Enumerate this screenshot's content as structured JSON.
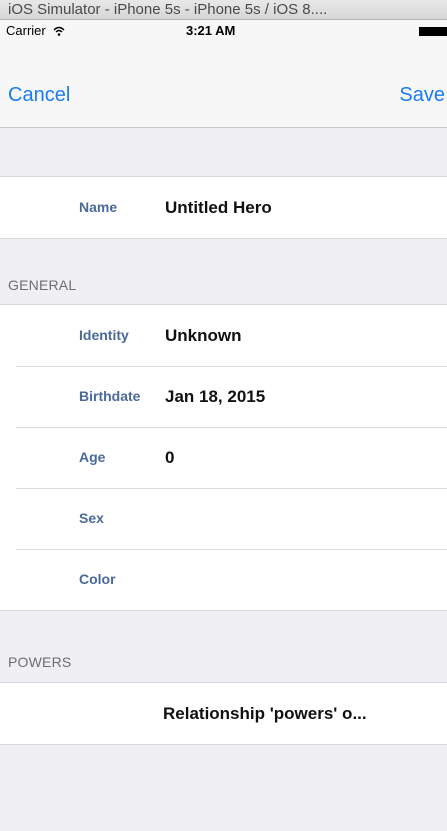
{
  "window": {
    "title": "iOS Simulator - iPhone 5s - iPhone 5s / iOS 8...."
  },
  "status": {
    "carrier": "Carrier",
    "time": "3:21 AM"
  },
  "nav": {
    "cancel_label": "Cancel",
    "save_label": "Save"
  },
  "name_row": {
    "label": "Name",
    "value": "Untitled Hero"
  },
  "general": {
    "header": "GENERAL",
    "rows": [
      {
        "label": "Identity",
        "value": "Unknown"
      },
      {
        "label": "Birthdate",
        "value": "Jan 18, 2015"
      },
      {
        "label": "Age",
        "value": "0"
      },
      {
        "label": "Sex",
        "value": ""
      },
      {
        "label": "Color",
        "value": ""
      }
    ]
  },
  "powers": {
    "header": "POWERS",
    "row_text": "Relationship 'powers' o..."
  },
  "colors": {
    "accent": "#1a7cf3",
    "label": "#4b6a9b",
    "background": "#efeff4"
  }
}
